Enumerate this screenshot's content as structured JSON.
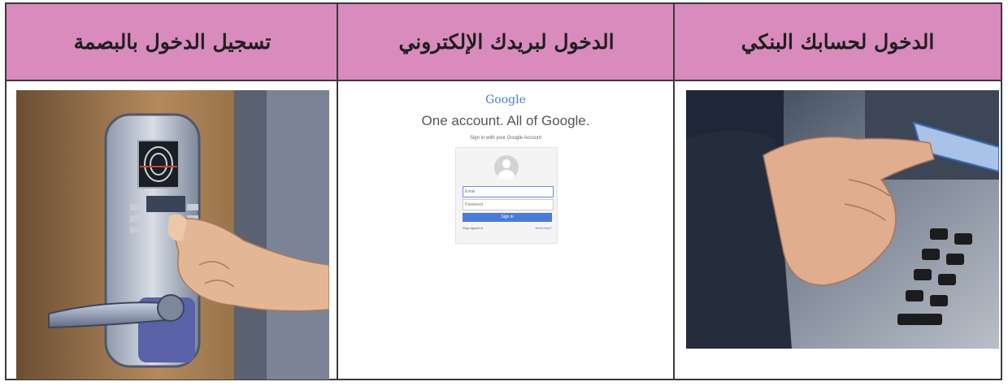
{
  "columns": [
    {
      "header": "تسجيل  الدخول بالبصمة"
    },
    {
      "header": "الدخول لبريدك الإلكتروني"
    },
    {
      "header": "الدخول لحسابك البنكي"
    }
  ],
  "google_login": {
    "logo": "Google",
    "heading": "One account. All of Google.",
    "subheading": "Sign in with your Google Account",
    "email_placeholder": "Email",
    "password_placeholder": "Password",
    "sign_in_label": "Sign in",
    "stay_signed_in": "Stay signed in",
    "need_help": "Need help?"
  },
  "colors": {
    "header_bg": "#d98bbd",
    "border": "#3a3a3a",
    "google_blue": "#4a7bd8"
  }
}
